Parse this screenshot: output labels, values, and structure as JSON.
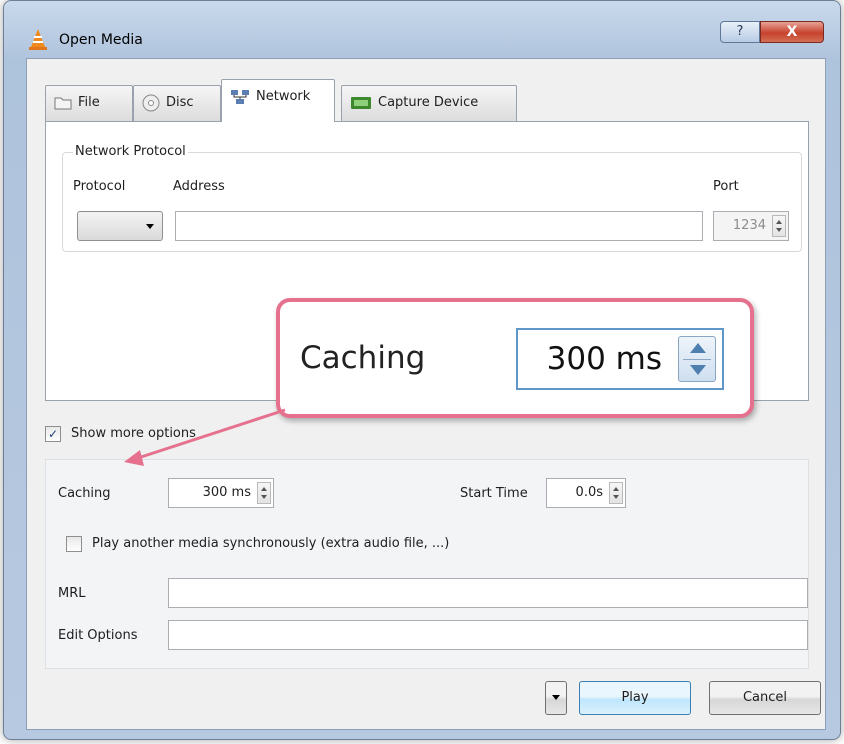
{
  "window": {
    "title": "Open Media",
    "help_label": "?",
    "close_label": "X"
  },
  "tabs": [
    {
      "label": "File",
      "icon": "folder-icon"
    },
    {
      "label": "Disc",
      "icon": "disc-icon"
    },
    {
      "label": "Network",
      "icon": "network-icon"
    },
    {
      "label": "Capture Device",
      "icon": "capture-device-icon"
    }
  ],
  "active_tab": "Network",
  "network": {
    "group_title": "Network Protocol",
    "protocol_label": "Protocol",
    "protocol_value": "",
    "address_label": "Address",
    "address_value": "",
    "port_label": "Port",
    "port_value": "1234"
  },
  "show_more": {
    "label": "Show more options",
    "checked": true,
    "check_mark": "✓"
  },
  "options": {
    "caching_label": "Caching",
    "caching_value": "300 ms",
    "start_time_label": "Start Time",
    "start_time_value": "0.0s",
    "sync_label": "Play another media synchronously (extra audio file, ...)",
    "sync_checked": false,
    "mrl_label": "MRL",
    "mrl_value": "",
    "edit_options_label": "Edit Options",
    "edit_options_value": ""
  },
  "buttons": {
    "play": "Play",
    "cancel": "Cancel"
  },
  "callout": {
    "label": "Caching",
    "value": "300 ms"
  },
  "colors": {
    "callout_border": "#e5718e",
    "arrow": "#e5718e"
  }
}
